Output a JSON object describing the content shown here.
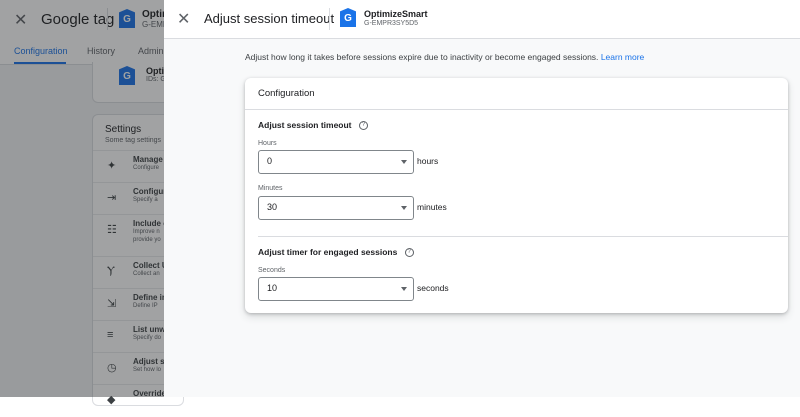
{
  "background": {
    "app_title": "Google tag",
    "tag_name": "Optim",
    "tag_id": "G-EMP",
    "tabs": [
      "Configuration",
      "History",
      "Admin"
    ],
    "card_tag_name": "Optim",
    "card_tag_id": "IDs: G",
    "settings_title": "Settings",
    "settings_subtitle": "Some tag settings",
    "rows": [
      {
        "title": "Manage",
        "sub": "Configure"
      },
      {
        "title": "Configur",
        "sub": "Specify a"
      },
      {
        "title": "Include c",
        "sub": "Improve n"
      },
      {
        "title": "Collect U",
        "sub": "Collect an"
      },
      {
        "title": "Define in",
        "sub": "Define IP"
      },
      {
        "title": "List unw",
        "sub": "Specify do"
      },
      {
        "title": "Adjust se",
        "sub": "Set how lo"
      },
      {
        "title": "Override",
        "sub": ""
      }
    ],
    "extra_sub": "provide yo"
  },
  "panel": {
    "title": "Adjust session timeout",
    "tag_name": "OptimizeSmart",
    "tag_id": "G-EMPR3SY5D5",
    "description": "Adjust how long it takes before sessions expire due to inactivity or become engaged sessions.",
    "learn_more": "Learn more",
    "card_title": "Configuration",
    "timeout_section": {
      "title": "Adjust session timeout",
      "hours_label": "Hours",
      "hours_value": "0",
      "hours_unit": "hours",
      "minutes_label": "Minutes",
      "minutes_value": "30",
      "minutes_unit": "minutes"
    },
    "engaged_section": {
      "title": "Adjust timer for engaged sessions",
      "seconds_label": "Seconds",
      "seconds_value": "10",
      "seconds_unit": "seconds"
    }
  },
  "icons": {
    "tag_letter": "G",
    "help": "?",
    "close": "✕"
  },
  "colors": {
    "accent": "#1a73e8",
    "scrim": "rgba(32,33,36,0.42)"
  }
}
